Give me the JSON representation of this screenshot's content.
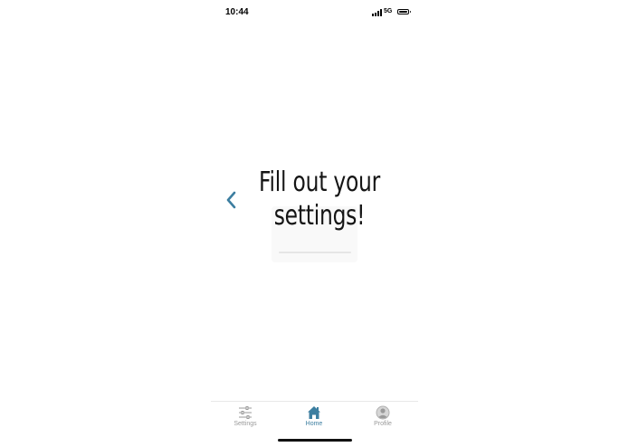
{
  "status_bar": {
    "time": "10:44",
    "network": "5G",
    "icons": [
      "signal-icon",
      "battery-icon"
    ]
  },
  "main": {
    "headline": "Fill out your\nsettings!",
    "back_icon": "chevron-left-icon"
  },
  "tab_bar": {
    "active_tab": "Home",
    "tabs": [
      {
        "label": "Settings",
        "icon": "sliders-icon"
      },
      {
        "label": "Home",
        "icon": "house-icon"
      },
      {
        "label": "Profile",
        "icon": "user-circle-icon"
      }
    ]
  },
  "colors": {
    "accent": "#3c7ea0",
    "inactive": "#9a9a9a",
    "text": "#151515",
    "background": "#ffffff"
  }
}
